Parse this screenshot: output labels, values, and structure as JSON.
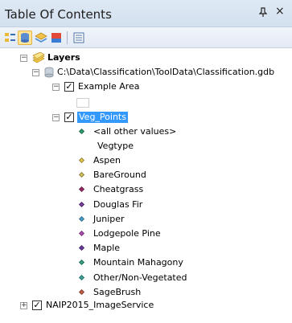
{
  "window": {
    "title": "Table Of Contents",
    "pin_glyph": "ⅎ",
    "close_glyph": "×"
  },
  "toolbar": {
    "buttons": [
      {
        "name": "list-by-drawing-order-icon"
      },
      {
        "name": "list-by-source-icon"
      },
      {
        "name": "list-by-visibility-icon"
      },
      {
        "name": "list-by-selection-icon"
      },
      {
        "name": "options-icon"
      }
    ]
  },
  "tree": {
    "layers_root": "Layers",
    "gdb_path": "C:\\Data\\Classification\\ToolData\\Classification.gdb",
    "example_area": "Example Area",
    "veg_points": "Veg_Points",
    "all_other_values": "<all other values>",
    "field_heading": "Vegtype",
    "classes": [
      {
        "label": "Aspen",
        "color": "#e8c84a"
      },
      {
        "label": "BareGround",
        "color": "#d4c25b"
      },
      {
        "label": "Cheatgrass",
        "color": "#9b2c6a"
      },
      {
        "label": "Douglas Fir",
        "color": "#7a3fa0"
      },
      {
        "label": "Juniper",
        "color": "#4aa3cf"
      },
      {
        "label": "Lodgepole Pine",
        "color": "#b24fb8"
      },
      {
        "label": "Maple",
        "color": "#6a3a9e"
      },
      {
        "label": "Mountain Mahagony",
        "color": "#35a586"
      },
      {
        "label": "Other/Non-Vegetated",
        "color": "#3fa6a0"
      },
      {
        "label": "SageBrush",
        "color": "#c65e43"
      }
    ],
    "all_other_color": "#2e9f6e",
    "imageservice": "NAIP2015_ImageService"
  },
  "glyphs": {
    "minus": "−",
    "plus": "+",
    "check": "✓"
  }
}
